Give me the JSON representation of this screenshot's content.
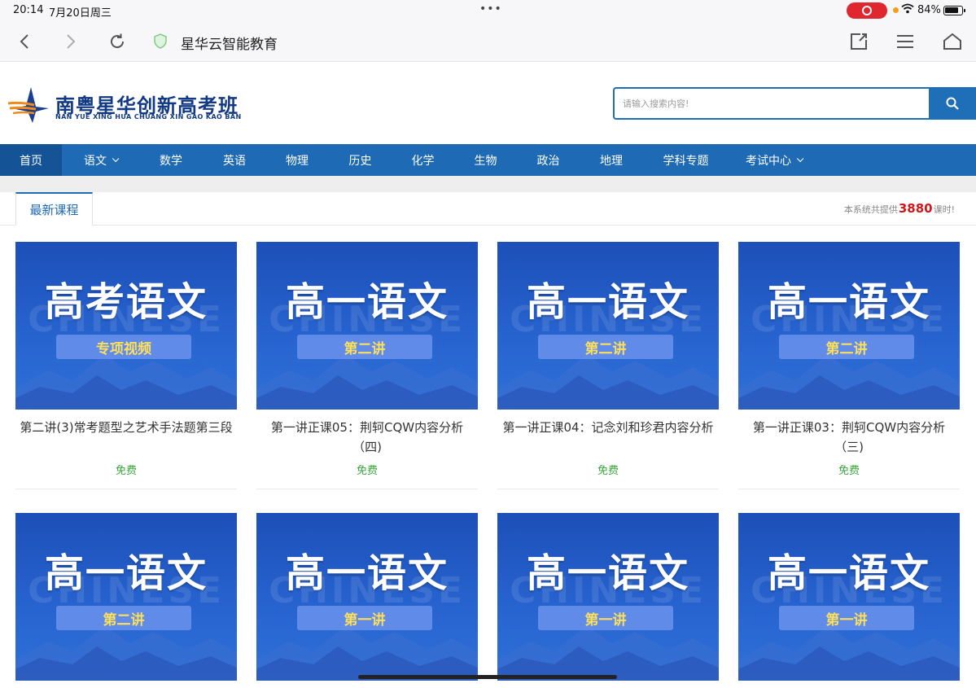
{
  "status": {
    "time": "20:14",
    "date": "7月20日周三",
    "battery": "84%"
  },
  "browser": {
    "site_title": "星华云智能教育"
  },
  "logo": {
    "name": "南粤星华创新高考班",
    "pinyin": "NAN YUE XING HUA CHUANG XIN GAO KAO BAN"
  },
  "search": {
    "placeholder": "请输入搜索内容!"
  },
  "nav": [
    {
      "label": "首页",
      "active": true,
      "dropdown": false
    },
    {
      "label": "语文",
      "dropdown": true
    },
    {
      "label": "数学"
    },
    {
      "label": "英语"
    },
    {
      "label": "物理"
    },
    {
      "label": "历史"
    },
    {
      "label": "化学"
    },
    {
      "label": "生物"
    },
    {
      "label": "政治"
    },
    {
      "label": "地理"
    },
    {
      "label": "学科专题"
    },
    {
      "label": "考试中心",
      "dropdown": true
    }
  ],
  "section": {
    "tab": "最新课程",
    "total_prefix": "本系统共提供",
    "total_count": "3880",
    "total_suffix": "课时!"
  },
  "courses": [
    {
      "thumb_title": "高考语文",
      "thumb_badge": "专项视频",
      "title": "第二讲(3)常考题型之艺术手法题第三段",
      "price": "免费"
    },
    {
      "thumb_title": "高一语文",
      "thumb_badge": "第二讲",
      "title": "第一讲正课05：荆轲CQW内容分析（四)",
      "price": "免费"
    },
    {
      "thumb_title": "高一语文",
      "thumb_badge": "第二讲",
      "title": "第一讲正课04：记念刘和珍君内容分析",
      "price": "免费"
    },
    {
      "thumb_title": "高一语文",
      "thumb_badge": "第二讲",
      "title": "第一讲正课03：荆轲CQW内容分析（三)",
      "price": "免费"
    },
    {
      "thumb_title": "高一语文",
      "thumb_badge": "第二讲"
    },
    {
      "thumb_title": "高一语文",
      "thumb_badge": "第一讲"
    },
    {
      "thumb_title": "高一语文",
      "thumb_badge": "第一讲"
    },
    {
      "thumb_title": "高一语文",
      "thumb_badge": "第一讲"
    }
  ],
  "thumb_watermark": "CHINESE",
  "colors": {
    "primary": "#1e6ab5",
    "nav_active": "#145496",
    "price": "#3aa73a",
    "count": "#d0181c",
    "badge_text": "#fde05a"
  }
}
